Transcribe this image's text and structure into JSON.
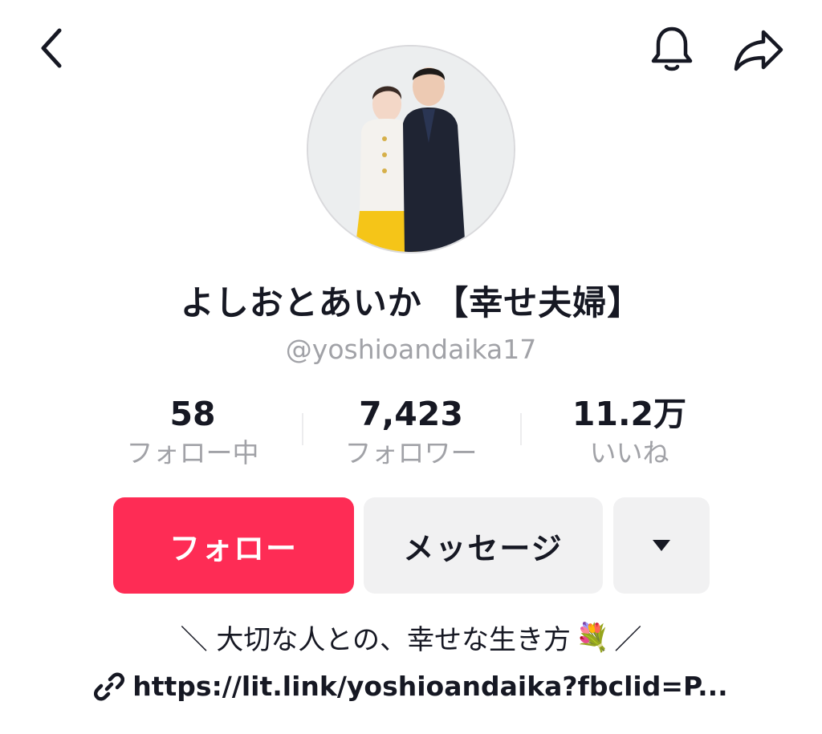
{
  "header": {
    "back_icon": "chevron-left-icon",
    "bell_icon": "bell-icon",
    "share_icon": "share-arrow-icon"
  },
  "profile": {
    "display_name": "よしおとあいか 【幸せ夫婦】",
    "username": "@yoshioandaika17",
    "avatar": "couple-photo"
  },
  "stats": [
    {
      "value": "58",
      "label": "フォロー中"
    },
    {
      "value": "7,423",
      "label": "フォロワー"
    },
    {
      "value": "11.2万",
      "label": "いいね"
    }
  ],
  "actions": {
    "follow_label": "フォロー",
    "message_label": "メッセージ",
    "more_icon": "caret-down-icon"
  },
  "bio": {
    "text_left": "＼ 大切な人との、幸せな生き方",
    "emoji": "💐",
    "text_right": " ／"
  },
  "link": {
    "icon": "link-icon",
    "url_text": "https://lit.link/yoshioandaika?fbclid=P..."
  },
  "colors": {
    "accent": "#fe2c55",
    "secondary_bg": "#f1f1f2",
    "muted_text": "#a1a2a7",
    "text": "#161823"
  }
}
